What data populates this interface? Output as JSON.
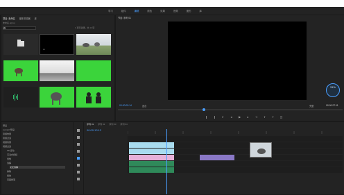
{
  "colors": {
    "accent": "#4a9eff",
    "green_screen": "#3bd43b",
    "clip_blue": "#a9dcef",
    "clip_pink": "#e7b1d9",
    "clip_purple": "#8a78c6",
    "audio_green": "#2fb56a"
  },
  "workspace_tabs": [
    "学习",
    "组件",
    "编辑",
    "颜色",
    "效果",
    "音频",
    "图形",
    "库"
  ],
  "workspace_active_index": 2,
  "project": {
    "tabs": [
      "项目: 未命名",
      "媒体浏览器",
      "库"
    ],
    "path": "未命名.prproj",
    "count": "1 项已选择，共 11 项",
    "items": [
      {
        "label": "",
        "dur": "",
        "thumb": "folder"
      },
      {
        "label": "",
        "dur": "",
        "thumb": "black"
      },
      {
        "label": "",
        "dur": "",
        "thumb": "elephant-grass"
      },
      {
        "label": "",
        "dur": "",
        "thumb": "elephant-green"
      },
      {
        "label": "",
        "dur": "",
        "thumb": "sky"
      },
      {
        "label": "",
        "dur": "",
        "thumb": "green"
      },
      {
        "label": "",
        "dur": "",
        "thumb": "audio"
      },
      {
        "label": "",
        "dur": "",
        "thumb": "elephant-green2"
      },
      {
        "label": "",
        "dur": "",
        "thumb": "people-green"
      }
    ]
  },
  "program": {
    "title": "节目: 序列 01",
    "timecode_left": "00:00:05:14",
    "fit": "适合",
    "quality": "完整",
    "timecode_right": "00:00:27:11",
    "badge": "31%"
  },
  "effects": {
    "rows": [
      "预设",
      "Lumetri 预设",
      "音频效果",
      "音频过渡",
      "视频效果",
      "视频过渡",
      "3D 运动",
      "沉浸式视频",
      "划像",
      "溶解",
      "交叉溶解",
      "擦除",
      "缩放",
      "页面剥落"
    ],
    "selected_index": 10
  },
  "timeline": {
    "tabs": [
      "序列 01",
      "序列 02",
      "序列 03",
      "序列 04"
    ],
    "timecode": "00:00:13:12"
  }
}
